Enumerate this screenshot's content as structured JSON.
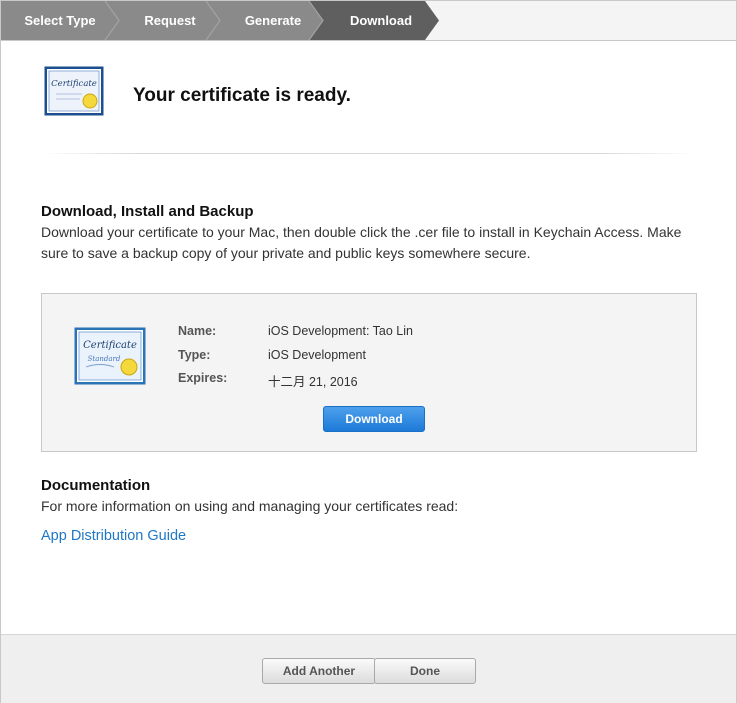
{
  "steps": [
    "Select Type",
    "Request",
    "Generate",
    "Download"
  ],
  "header": {
    "title": "Your certificate is ready."
  },
  "icons": {
    "small_cert_text": "Certificate",
    "large_cert_text": "Certificate",
    "large_cert_sub": "Standard"
  },
  "download_section": {
    "heading": "Download, Install and Backup",
    "body": "Download your certificate to your Mac, then double click the .cer file to install in Keychain Access. Make sure to save a backup copy of your private and public keys somewhere secure."
  },
  "certificate": {
    "name_label": "Name:",
    "name_value": "iOS Development: Tao Lin",
    "type_label": "Type:",
    "type_value": "iOS Development",
    "expires_label": "Expires:",
    "expires_value": "十二月 21, 2016",
    "download_button": "Download"
  },
  "documentation": {
    "heading": "Documentation",
    "body": "For more information on using and managing your certificates read:",
    "link": "App Distribution Guide"
  },
  "footer": {
    "add_another": "Add Another",
    "done": "Done"
  },
  "colors": {
    "step_bg": "#8a8a8a",
    "step_active_bg": "#5f5f5f",
    "link": "#1f77c7",
    "primary_button": "#1d7ad8"
  }
}
